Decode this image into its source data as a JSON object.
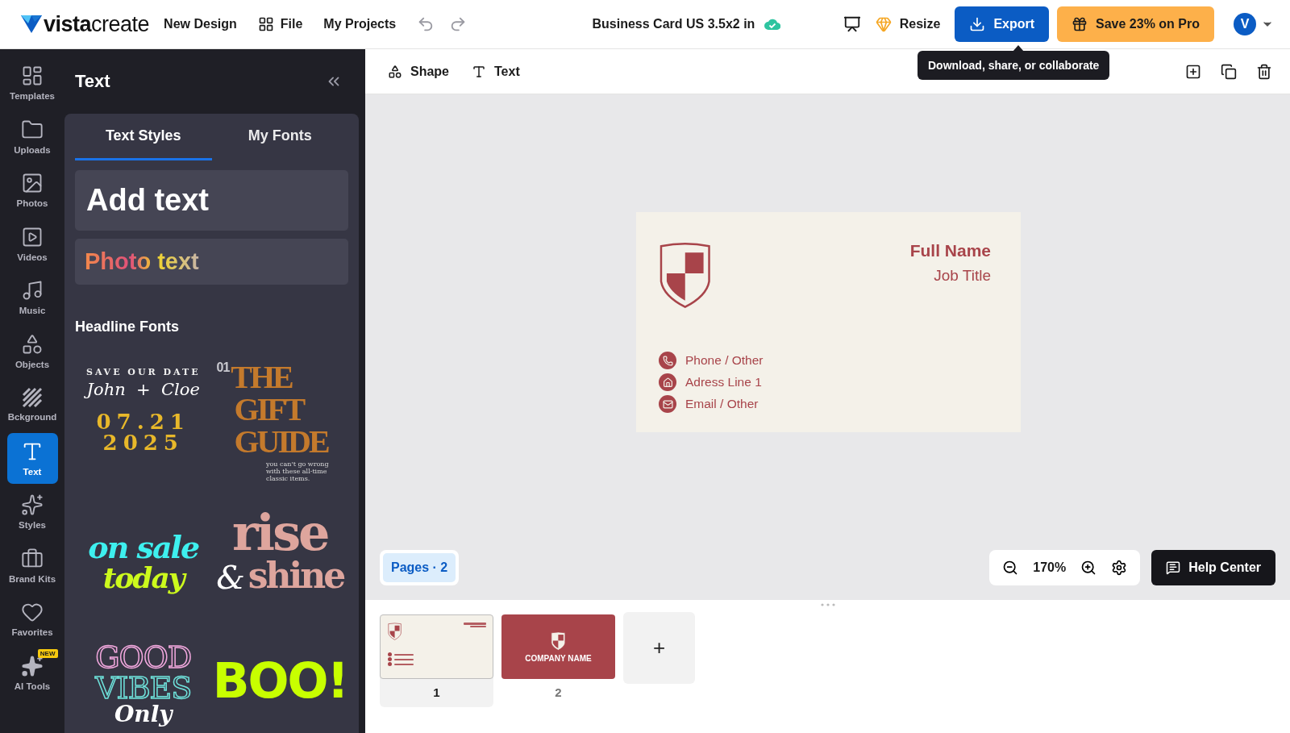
{
  "topbar": {
    "logo": "**vista**create",
    "menu": [
      {
        "label": "New Design",
        "kind": "plain"
      },
      {
        "label": "File",
        "kind": "grid"
      },
      {
        "label": "My Projects",
        "kind": "plain"
      }
    ],
    "title": "Business Card US 3.5x2 in",
    "resize": "Resize",
    "export": "Export",
    "promo": "Save 23% on Pro",
    "avatar": "V"
  },
  "tooltip": "Download, share, or collaborate",
  "rail": [
    {
      "label": "Templates",
      "selected": false
    },
    {
      "label": "Uploads",
      "selected": false
    },
    {
      "label": "Photos",
      "selected": false
    },
    {
      "label": "Videos",
      "selected": false
    },
    {
      "label": "Music",
      "selected": false
    },
    {
      "label": "Objects",
      "selected": false
    },
    {
      "label": "Bckground",
      "selected": false
    },
    {
      "label": "Text",
      "selected": true
    },
    {
      "label": "Styles",
      "selected": false
    },
    {
      "label": "Brand Kits",
      "selected": false
    },
    {
      "label": "Favorites",
      "selected": false
    },
    {
      "label": "AI Tools",
      "selected": false,
      "badge": "NEW"
    }
  ],
  "panel": {
    "title": "Text",
    "tabs": [
      {
        "label": "Text Styles",
        "selected": true
      },
      {
        "label": "My Fonts",
        "selected": false
      }
    ],
    "add_text": "Add text",
    "photo_text": "Photo text",
    "section": "Headline Fonts",
    "samples": [
      {
        "kind": "save-date",
        "lines": [
          "SAVE OUR DATE",
          "John  +  Cloe",
          "07.21",
          "2025"
        ]
      },
      {
        "kind": "gift-guide",
        "lines": [
          "01",
          "THE",
          "GIFT",
          "GUIDE",
          "you can't go wrong with these all-time classic items."
        ]
      },
      {
        "kind": "on-sale",
        "lines": [
          "on sale",
          "today"
        ]
      },
      {
        "kind": "rise-shine",
        "lines": [
          "rise",
          "&",
          "shine"
        ]
      },
      {
        "kind": "good-vibes",
        "lines": [
          "GOOD",
          "VIBES",
          "Only"
        ]
      },
      {
        "kind": "boo",
        "lines": [
          "BOO!"
        ]
      }
    ]
  },
  "toolbar": {
    "tools": [
      {
        "label": "Shape"
      },
      {
        "label": "Text"
      }
    ]
  },
  "card": {
    "name": "Full Name",
    "job": "Job Title",
    "contacts": [
      "Phone / Other",
      "Adress Line 1",
      "Email / Other"
    ]
  },
  "pages_badge": "Pages · 2",
  "zoom": "170%",
  "help": "Help Center",
  "pages": [
    {
      "number": "1",
      "kind": "front",
      "selected": true
    },
    {
      "number": "2",
      "kind": "back",
      "company": "COMPANY NAME",
      "selected": false
    }
  ],
  "add_page": "+"
}
